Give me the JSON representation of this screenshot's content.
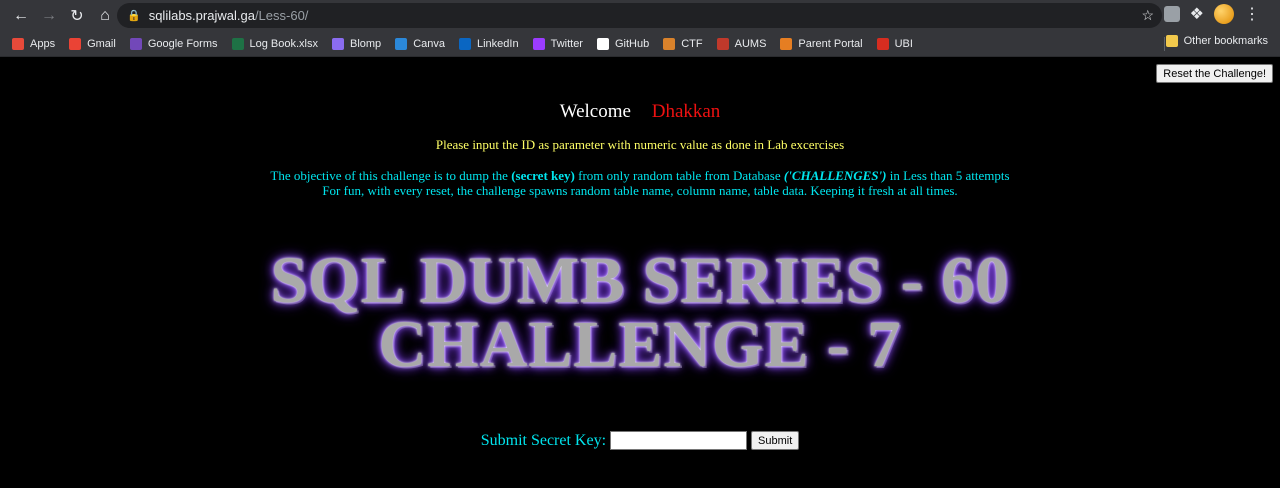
{
  "browser": {
    "url_host": "sqlilabs.prajwal.ga",
    "url_path": "/Less-60/"
  },
  "bookmarks": [
    {
      "label": "Apps",
      "icon": "apps-grid-icon",
      "color": "#e84a3a"
    },
    {
      "label": "Gmail",
      "icon": "gmail-icon",
      "color": "#ea4335"
    },
    {
      "label": "Google Forms",
      "icon": "google-forms-icon",
      "color": "#7248b9"
    },
    {
      "label": "Log Book.xlsx",
      "icon": "excel-icon",
      "color": "#1e7145"
    },
    {
      "label": "Blomp",
      "icon": "blomp-icon",
      "color": "#8a6cf0"
    },
    {
      "label": "Canva",
      "icon": "canva-icon",
      "color": "#2b88d9"
    },
    {
      "label": "LinkedIn",
      "icon": "linkedin-icon",
      "color": "#0a66c2"
    },
    {
      "label": "Twitter",
      "icon": "twitter-icon",
      "color": "#9b3cff"
    },
    {
      "label": "GitHub",
      "icon": "github-icon",
      "color": "#ffffff"
    },
    {
      "label": "CTF",
      "icon": "ctf-icon",
      "color": "#d9822b"
    },
    {
      "label": "AUMS",
      "icon": "aums-icon",
      "color": "#c0392b"
    },
    {
      "label": "Parent Portal",
      "icon": "parent-portal-icon",
      "color": "#e67e22"
    },
    {
      "label": "UBI",
      "icon": "ubi-icon",
      "color": "#d62d20"
    }
  ],
  "other_bookmarks": "Other bookmarks",
  "page": {
    "reset_label": "Reset the Challenge!",
    "welcome_label": "Welcome",
    "user_name": "Dhakkan",
    "instruction": "Please input the ID as parameter with numeric value as done in Lab excercises",
    "objective_pre": "The objective of this challenge is to dump the ",
    "objective_key": "(secret key)",
    "objective_mid": " from only random table from Database ",
    "objective_db": "('CHALLENGES')",
    "objective_post": " in Less than 5 attempts",
    "fun_line": "For fun, with every reset, the challenge spawns random table name, column name, table data. Keeping it fresh at all times.",
    "banner_line1": "SQL DUMB SERIES - 60",
    "banner_line2": "CHALLENGE - 7",
    "submit_label": "Submit Secret Key:",
    "submit_button": "Submit",
    "key_value": ""
  }
}
